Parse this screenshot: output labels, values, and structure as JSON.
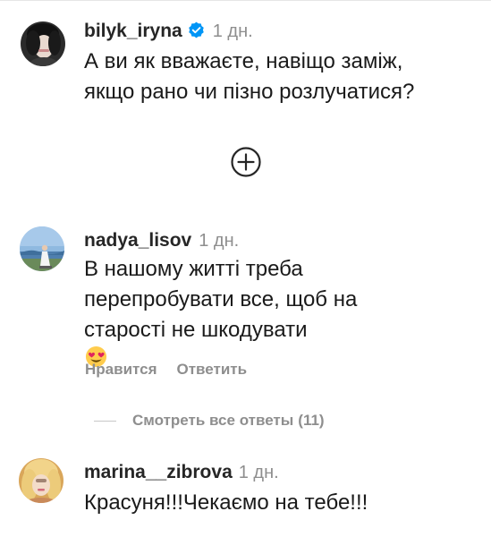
{
  "comments": [
    {
      "username": "bilyk_iryna",
      "verified": true,
      "time": "1 дн.",
      "lines": [
        "А ви як вважаєте, навіщо заміж,",
        "якщо рано чи пізно розлучатися?"
      ]
    },
    {
      "username": "nadya_lisov",
      "time": "1 дн.",
      "lines": [
        "В нашому житті треба",
        "перепробувати все, щоб на",
        "старості не шкодувати"
      ],
      "emoji": "smiling-face-with-heart-eyes",
      "actions": {
        "like": "Нравится",
        "reply": "Ответить"
      },
      "view_replies": {
        "label": "Смотреть все ответы",
        "count": "(11)"
      }
    },
    {
      "username": "marina__zibrova",
      "time": "1 дн.",
      "lines": [
        "Красуня!!!Чекаємо на тебе!!!"
      ]
    }
  ],
  "load_more_icon": "plus-circle-icon",
  "colors": {
    "text": "#262626",
    "secondary": "#8e8e8e",
    "verified": "#0095f6"
  }
}
